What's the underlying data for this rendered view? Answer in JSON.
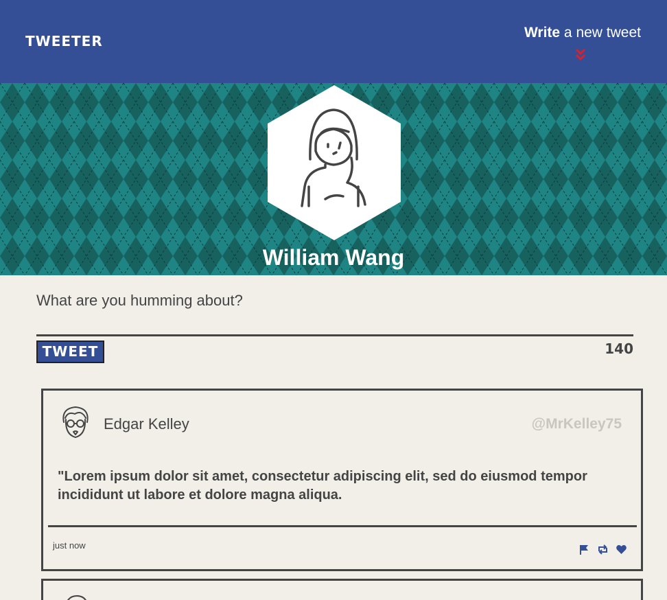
{
  "nav": {
    "brand": "TWEETER",
    "compose_strong": "Write",
    "compose_rest": " a new tweet",
    "chevron_icon": "double-chevron-down-icon",
    "color": "#354f96",
    "accent": "#d9202c"
  },
  "profile": {
    "name": "William Wang",
    "avatar_icon": "woman-avatar-icon"
  },
  "composer": {
    "placeholder": "What are you humming about?",
    "button_label": "TWEET",
    "counter": "140"
  },
  "tweets": [
    {
      "author": "Edgar Kelley",
      "handle": "@MrKelley75",
      "avatar_icon": "glasses-man-avatar-icon",
      "text": "\"Lorem ipsum dolor sit amet, consectetur adipiscing elit, sed do eiusmod tempor incididunt ut labore et dolore magna aliqua.",
      "time": "just now",
      "actions": [
        "flag-icon",
        "retweet-icon",
        "heart-icon"
      ]
    }
  ]
}
